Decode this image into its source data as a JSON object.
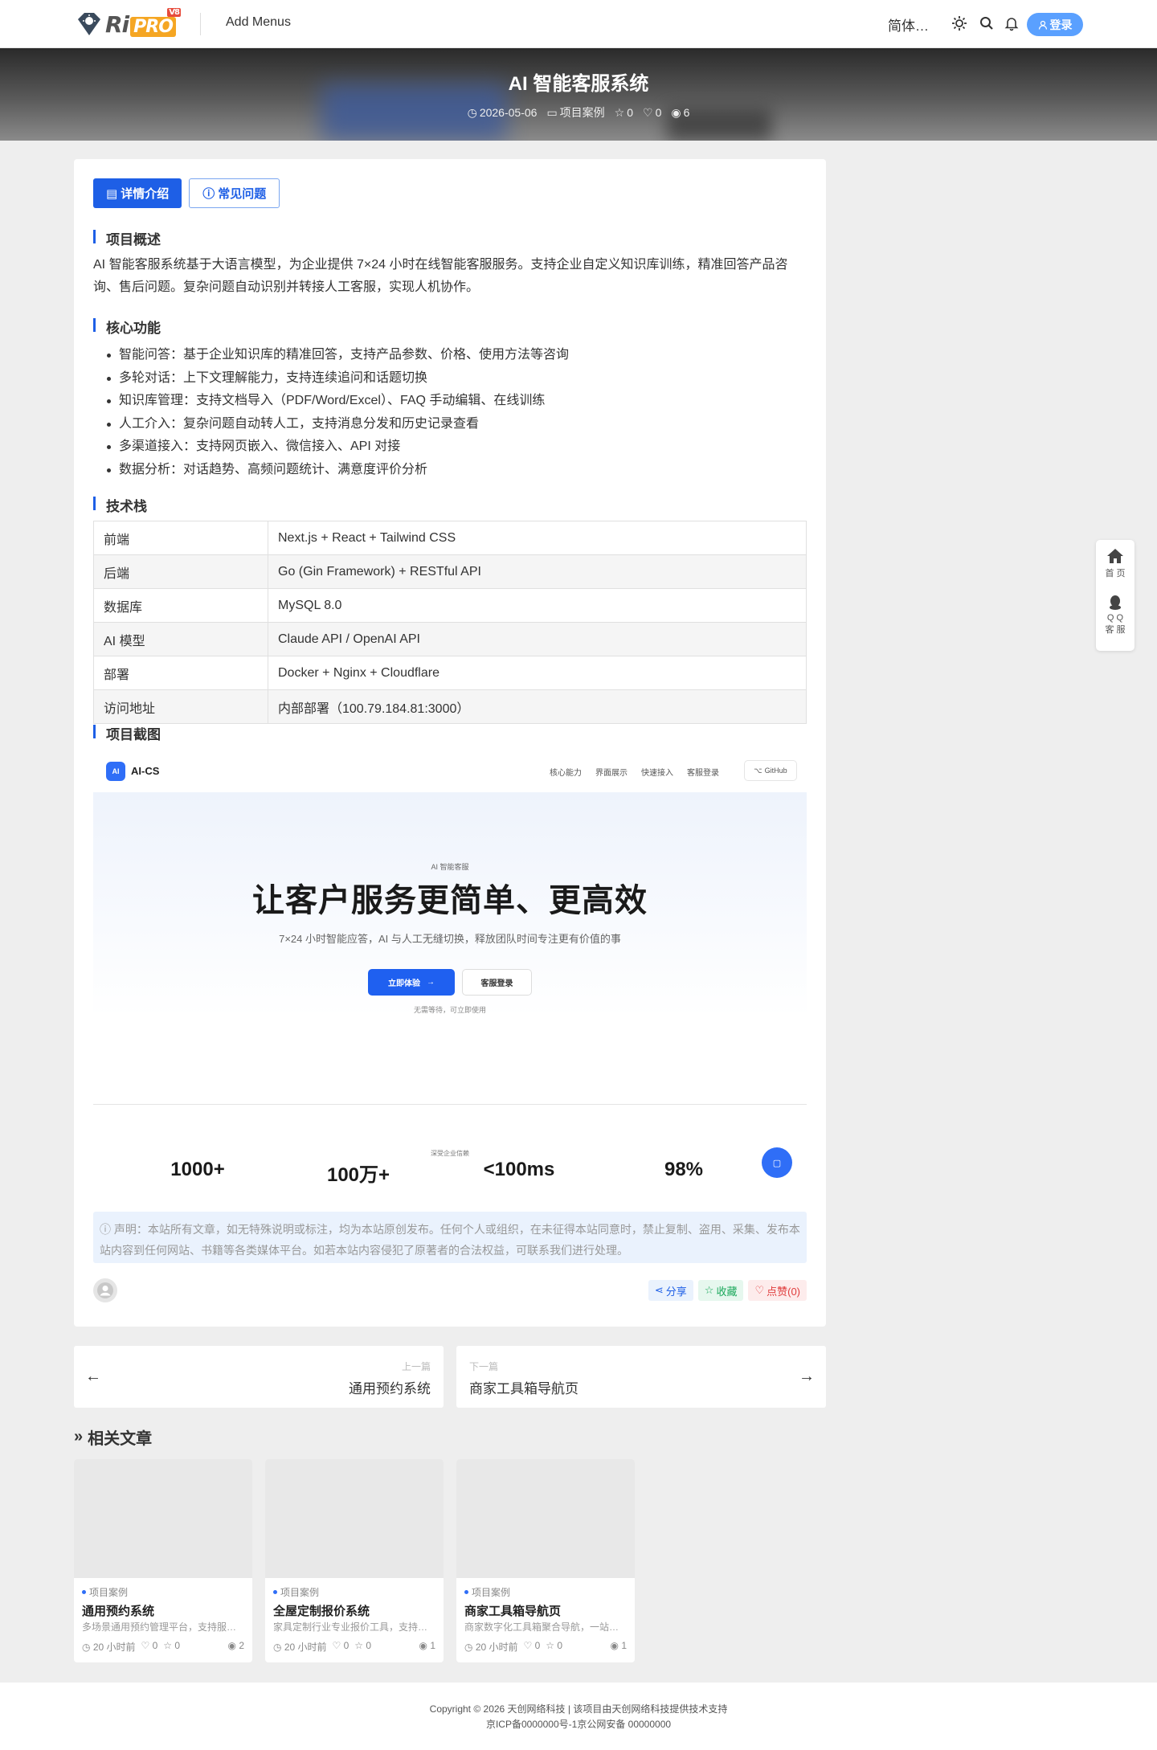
{
  "header": {
    "logo_text": "Ri",
    "logo_pro": "PRO",
    "logo_version": "V8",
    "menu_label": "Add Menus",
    "language": "简体…",
    "login_label": "登录",
    "icons": [
      "theme-icon",
      "search-icon",
      "bell-icon",
      "user-icon"
    ]
  },
  "hero": {
    "title": "AI 智能客服系统",
    "date": "2026-05-06",
    "category": "项目案例",
    "favorites": "0",
    "likes": "0",
    "views": "6"
  },
  "article": {
    "tabs": [
      "详情介绍",
      "常见问题"
    ],
    "overview_heading": "项目概述",
    "overview_text": "AI 智能客服系统基于大语言模型，为企业提供 7×24 小时在线智能客服服务。支持企业自定义知识库训练，精准回答产品咨询、售后问题。复杂问题自动识别并转接人工客服，实现人机协作。",
    "features_heading": "核心功能",
    "features": [
      "智能问答：基于企业知识库的精准回答，支持产品参数、价格、使用方法等咨询",
      "多轮对话：上下文理解能力，支持连续追问和话题切换",
      "知识库管理：支持文档导入（PDF/Word/Excel）、FAQ 手动编辑、在线训练",
      "人工介入：复杂问题自动转人工，支持消息分发和历史记录查看",
      "多渠道接入：支持网页嵌入、微信接入、API 对接",
      "数据分析：对话趋势、高频问题统计、满意度评价分析"
    ],
    "tech_heading": "技术栈",
    "tech_rows": [
      [
        "前端",
        "Next.js + React + Tailwind CSS"
      ],
      [
        "后端",
        "Go (Gin Framework) + RESTful API"
      ],
      [
        "数据库",
        "MySQL 8.0"
      ],
      [
        "AI 模型",
        "Claude API / OpenAI API"
      ],
      [
        "部署",
        "Docker + Nginx + Cloudflare"
      ],
      [
        "访问地址",
        "内部部署（100.79.184.81:3000）"
      ]
    ],
    "screenshot_heading": "项目截图",
    "notice": "声明：本站所有文章，如无特殊说明或标注，均为本站原创发布。任何个人或组织，在未征得本站同意时，禁止复制、盗用、采集、发布本站内容到任何网站、书籍等各类媒体平台。如若本站内容侵犯了原著者的合法权益，可联系我们进行处理。",
    "actions": {
      "share": "分享",
      "favorite": "收藏",
      "like": "点赞(0)"
    }
  },
  "screenshot": {
    "logo_mark": "AI",
    "brand": "AI-CS",
    "nav_links": [
      "核心能力",
      "界面展示",
      "快速接入",
      "客服登录"
    ],
    "github": "GitHub",
    "tag": "AI 智能客服",
    "headline": "让客户服务更简单、更高效",
    "subline": "7×24 小时智能应答，AI 与人工无缝切换，释放团队时间专注更有价值的事",
    "primary_button": "立即体验",
    "secondary_button": "客服登录",
    "note": "无需等待，可立即使用",
    "trust_label": "深受企业信赖",
    "stats": [
      "1000+",
      "100万+",
      "<100ms",
      "98%"
    ]
  },
  "navigation": {
    "prev_label": "上一篇",
    "prev_title": "通用预约系统",
    "next_label": "下一篇",
    "next_title": "商家工具箱导航页"
  },
  "related": {
    "heading": "相关文章",
    "items": [
      {
        "category": "项目案例",
        "title": "通用预约系统",
        "desc": "多场景通用预约管理平台，支持服…",
        "time": "20 小时前",
        "likes": "0",
        "favs": "0",
        "views": "2"
      },
      {
        "category": "项目案例",
        "title": "全屋定制报价系统",
        "desc": "家具定制行业专业报价工具，支持…",
        "time": "20 小时前",
        "likes": "0",
        "favs": "0",
        "views": "1"
      },
      {
        "category": "项目案例",
        "title": "商家工具箱导航页",
        "desc": "商家数字化工具箱聚合导航，一站…",
        "time": "20 小时前",
        "likes": "0",
        "favs": "0",
        "views": "1"
      }
    ]
  },
  "footer": {
    "copyright": "Copyright © 2026 天创网络科技 | 该项目由天创网络科技提供技术支持",
    "icp": "京ICP备0000000号-1京公网安备 00000000"
  },
  "side": {
    "home": "首 页",
    "qq1": "Q Q",
    "qq2": "客 服"
  },
  "colors": {
    "primary": "#1e5fe6",
    "login": "#5aa0ff",
    "logo_orange": "#f5a623"
  }
}
